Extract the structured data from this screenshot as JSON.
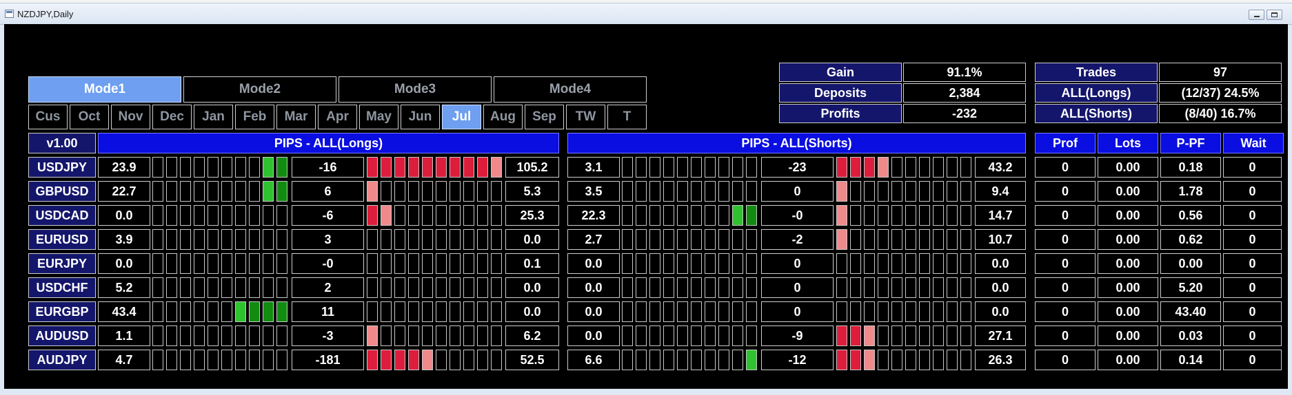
{
  "window": {
    "title": "NZDJPY,Daily"
  },
  "modes": [
    "Mode1",
    "Mode2",
    "Mode3",
    "Mode4"
  ],
  "active_mode": 0,
  "months": [
    "Cus",
    "Oct",
    "Nov",
    "Dec",
    "Jan",
    "Feb",
    "Mar",
    "Apr",
    "May",
    "Jun",
    "Jul",
    "Aug",
    "Sep",
    "TW",
    "T"
  ],
  "active_month": 10,
  "stats_left": [
    {
      "label": "Gain",
      "value": "91.1%"
    },
    {
      "label": "Deposits",
      "value": "2,384"
    },
    {
      "label": "Profits",
      "value": "-232"
    }
  ],
  "stats_right": [
    {
      "label": "Trades",
      "value": "97"
    },
    {
      "label": "ALL(Longs)",
      "value": "(12/37) 24.5%"
    },
    {
      "label": "ALL(Shorts)",
      "value": "(8/40) 16.7%"
    }
  ],
  "version": "v1.00",
  "longs_header": "PIPS - ALL(Longs)",
  "shorts_header": "PIPS - ALL(Shorts)",
  "right_headers": [
    "Prof",
    "Lots",
    "P-PF",
    "Wait"
  ],
  "colors": {
    "green": "#2ec22e",
    "dark_green": "#118c11",
    "red": "#dc1e3c",
    "light_red": "#f08a8a",
    "header_blue": "#0a0ee0",
    "navy": "#14166b",
    "active_tab": "#6e9ff0"
  },
  "rows": [
    {
      "symbol": "USDJPY",
      "long_a": "23.9",
      "long_pips": "-16",
      "long_b": "105.2",
      "short_a": "3.1",
      "short_pips": "-23",
      "short_b": "43.2",
      "prof": "0",
      "lots": "0.00",
      "ppf": "0.18",
      "wait": "0",
      "lg": "........gd",
      "lr": "rrrrrrrrrl",
      "sg": "..........",
      "sr": "rrrl......"
    },
    {
      "symbol": "GBPUSD",
      "long_a": "22.7",
      "long_pips": "6",
      "long_b": "5.3",
      "short_a": "3.5",
      "short_pips": "0",
      "short_b": "9.4",
      "prof": "0",
      "lots": "0.00",
      "ppf": "1.78",
      "wait": "0",
      "lg": "........gd",
      "lr": "l.........",
      "sg": "..........",
      "sr": "l........."
    },
    {
      "symbol": "USDCAD",
      "long_a": "0.0",
      "long_pips": "-6",
      "long_b": "25.3",
      "short_a": "22.3",
      "short_pips": "-0",
      "short_b": "14.7",
      "prof": "0",
      "lots": "0.00",
      "ppf": "0.56",
      "wait": "0",
      "lg": "..........",
      "lr": "rl........",
      "sg": "........gd",
      "sr": "l........."
    },
    {
      "symbol": "EURUSD",
      "long_a": "3.9",
      "long_pips": "3",
      "long_b": "0.0",
      "short_a": "2.7",
      "short_pips": "-2",
      "short_b": "10.7",
      "prof": "0",
      "lots": "0.00",
      "ppf": "0.62",
      "wait": "0",
      "lg": "..........",
      "lr": "..........",
      "sg": "..........",
      "sr": "l........."
    },
    {
      "symbol": "EURJPY",
      "long_a": "0.0",
      "long_pips": "-0",
      "long_b": "0.1",
      "short_a": "0.0",
      "short_pips": "0",
      "short_b": "0.0",
      "prof": "0",
      "lots": "0.00",
      "ppf": "0.00",
      "wait": "0",
      "lg": "..........",
      "lr": "..........",
      "sg": "..........",
      "sr": ".........."
    },
    {
      "symbol": "USDCHF",
      "long_a": "5.2",
      "long_pips": "2",
      "long_b": "0.0",
      "short_a": "0.0",
      "short_pips": "0",
      "short_b": "0.0",
      "prof": "0",
      "lots": "0.00",
      "ppf": "5.20",
      "wait": "0",
      "lg": "..........",
      "lr": "..........",
      "sg": "..........",
      "sr": ".........."
    },
    {
      "symbol": "EURGBP",
      "long_a": "43.4",
      "long_pips": "11",
      "long_b": "0.0",
      "short_a": "0.0",
      "short_pips": "0",
      "short_b": "0.0",
      "prof": "0",
      "lots": "0.00",
      "ppf": "43.40",
      "wait": "0",
      "lg": "......gddd",
      "lr": "..........",
      "sg": "..........",
      "sr": ".........."
    },
    {
      "symbol": "AUDUSD",
      "long_a": "1.1",
      "long_pips": "-3",
      "long_b": "6.2",
      "short_a": "0.0",
      "short_pips": "-9",
      "short_b": "27.1",
      "prof": "0",
      "lots": "0.00",
      "ppf": "0.03",
      "wait": "0",
      "lg": "..........",
      "lr": "l.........",
      "sg": "..........",
      "sr": "rrl......."
    },
    {
      "symbol": "AUDJPY",
      "long_a": "4.7",
      "long_pips": "-181",
      "long_b": "52.5",
      "short_a": "6.6",
      "short_pips": "-12",
      "short_b": "26.3",
      "prof": "0",
      "lots": "0.00",
      "ppf": "0.14",
      "wait": "0",
      "lg": "..........",
      "lr": "rrrrl.....",
      "sg": ".........g",
      "sr": "rrl......."
    }
  ]
}
